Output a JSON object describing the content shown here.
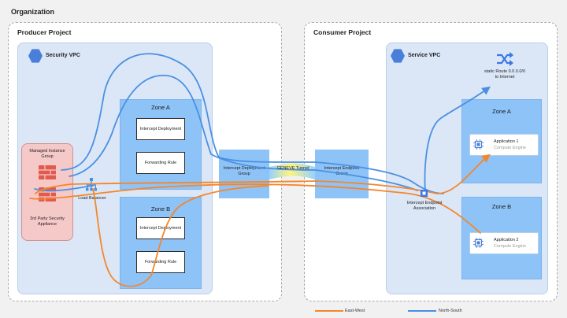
{
  "organization": {
    "title": "Organization"
  },
  "producer": {
    "title": "Producer Project",
    "vpc_title": "Security VPC",
    "zone_a": {
      "title": "Zone A",
      "deployment": "Intercept Deployment",
      "rule": "Forwarding Rule"
    },
    "zone_b": {
      "title": "Zone B",
      "deployment": "Intercept Deployment",
      "rule": "Forwarding Rule"
    },
    "mig_title": "Managed Instance Group",
    "appliance": "3rd Party Security Appliance",
    "load_balancer": "Load Balancer"
  },
  "tunnel": {
    "deployment_group": "Intercept Deployment Group",
    "label": "GENEVE Tunnel",
    "endpoint_group": "Intercept Endpoint Group"
  },
  "consumer": {
    "title": "Consumer Project",
    "vpc_title": "Service VPC",
    "static_route": "static Route 0.0.0.0/0 to Internet",
    "association": "Intercept Endpoint Association",
    "zone_a": {
      "title": "Zone A",
      "app_title": "Application 1",
      "app_sub": "Compute Engine"
    },
    "zone_b": {
      "title": "Zone B",
      "app_title": "Application 2",
      "app_sub": "Compute Engine"
    }
  },
  "legend": {
    "east_west": "East-West",
    "north_south": "North-South"
  },
  "colors": {
    "east_west": "#f5862a",
    "north_south": "#4a90e2",
    "brand": "#4a7fd9",
    "firewall": "#e05a4e"
  }
}
